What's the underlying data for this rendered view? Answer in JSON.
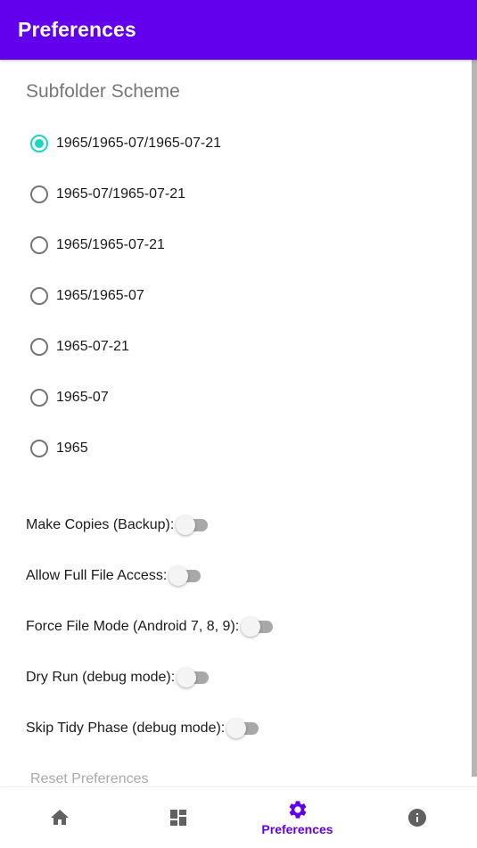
{
  "appbar": {
    "title": "Preferences"
  },
  "colors": {
    "primary": "#6200ee",
    "accent": "#1bd6c0",
    "icon_inactive": "#616161"
  },
  "subfolder_scheme": {
    "title": "Subfolder Scheme",
    "selected_index": 0,
    "options": [
      {
        "label": "1965/1965-07/1965-07-21",
        "checked": true
      },
      {
        "label": "1965-07/1965-07-21",
        "checked": false
      },
      {
        "label": "1965/1965-07-21",
        "checked": false
      },
      {
        "label": "1965/1965-07",
        "checked": false
      },
      {
        "label": "1965-07-21",
        "checked": false
      },
      {
        "label": "1965-07",
        "checked": false
      },
      {
        "label": "1965",
        "checked": false
      }
    ]
  },
  "switches": [
    {
      "label": "Make Copies (Backup):",
      "on": false
    },
    {
      "label": "Allow Full File Access:",
      "on": false
    },
    {
      "label": "Force File Mode (Android 7, 8, 9):",
      "on": false
    },
    {
      "label": "Dry Run (debug mode):",
      "on": false
    },
    {
      "label": "Skip Tidy Phase (debug mode):",
      "on": false
    }
  ],
  "reset_label": "Reset Preferences",
  "bottom_nav": {
    "items": [
      {
        "icon": "home-icon",
        "label": "",
        "active": false
      },
      {
        "icon": "dashboard-icon",
        "label": "",
        "active": false
      },
      {
        "icon": "gear-icon",
        "label": "Preferences",
        "active": true
      },
      {
        "icon": "info-icon",
        "label": "",
        "active": false
      }
    ]
  }
}
